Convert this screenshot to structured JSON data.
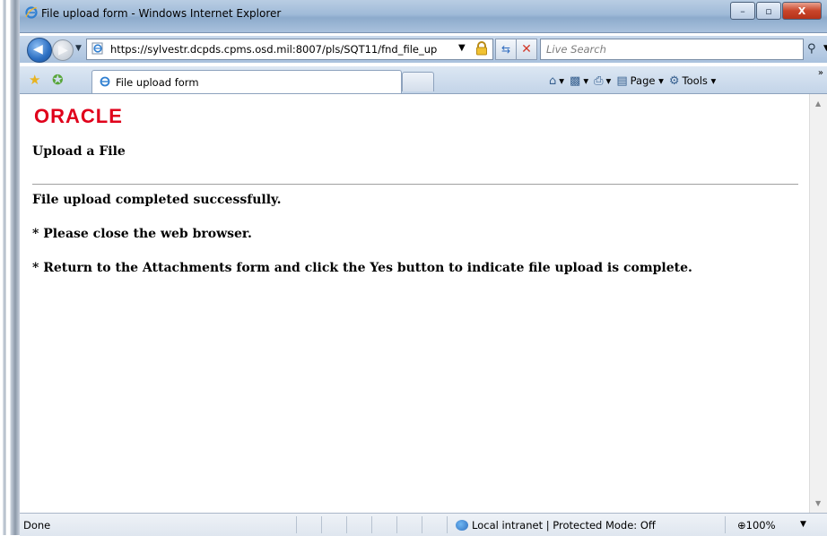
{
  "window": {
    "title": "File upload form - Windows Internet Explorer",
    "buttons": {
      "minimize": "–",
      "maximize": "▫",
      "close": "X"
    }
  },
  "address_bar": {
    "url": "https://sylvestr.dcpds.cpms.osd.mil:8007/pls/SQT11/fnd_file_up",
    "search_placeholder": "Live Search"
  },
  "tabs": [
    {
      "label": "File upload form",
      "active": true
    }
  ],
  "command_bar": {
    "page_label": "Page",
    "tools_label": "Tools"
  },
  "page": {
    "logo_text": "ORACLE",
    "logo_color": "#e0001b",
    "heading": "Upload a File",
    "messages": [
      "File upload completed successfully.",
      "* Please close the web browser.",
      "* Return to the Attachments form and click the Yes button to indicate file upload is complete."
    ]
  },
  "status_bar": {
    "status": "Done",
    "zone": "Local intranet | Protected Mode: Off",
    "zoom": "100%"
  }
}
